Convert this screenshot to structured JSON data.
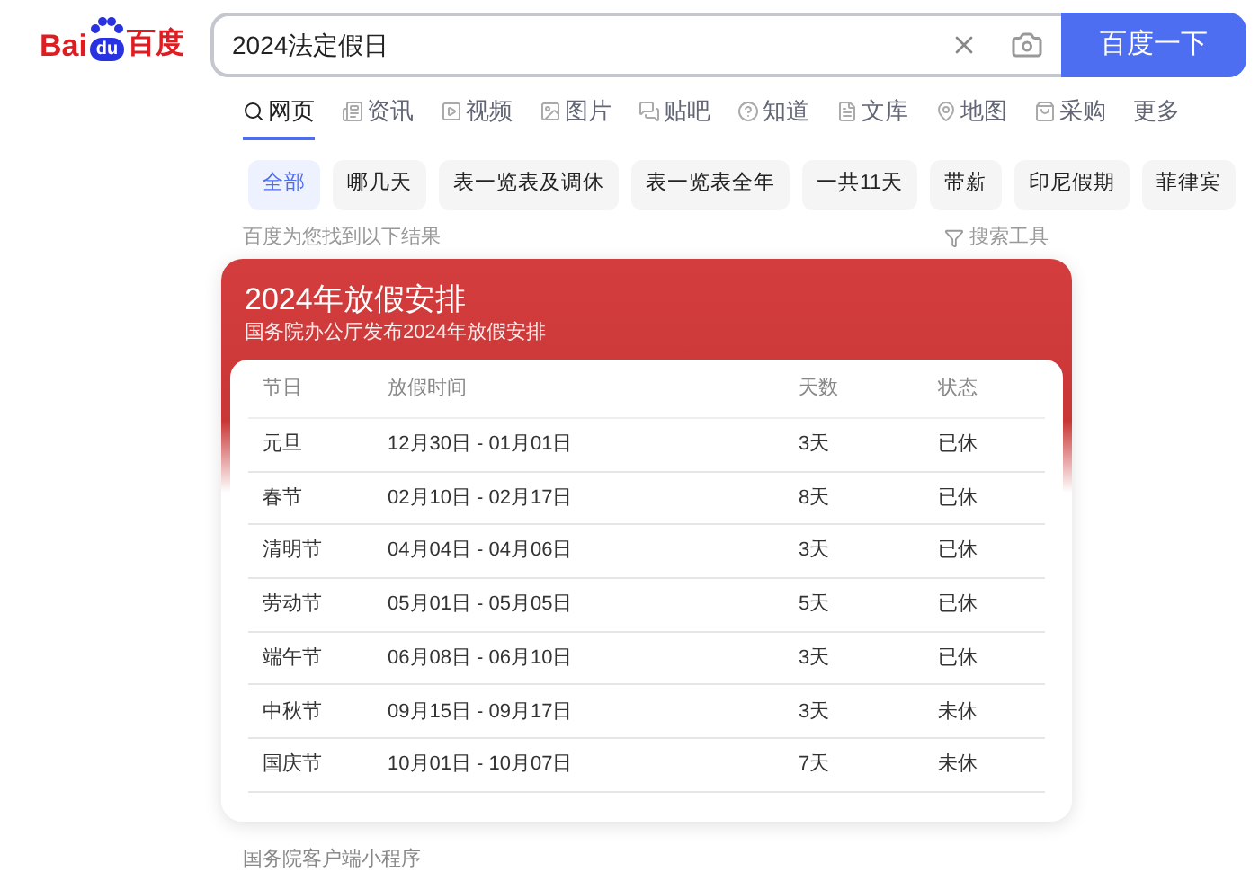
{
  "logo": {
    "left": "Bai",
    "paw": "du",
    "right": "百度"
  },
  "search": {
    "value": "2024法定假日",
    "button": "百度一下"
  },
  "tabs": [
    {
      "label": "网页",
      "kind": "search",
      "selected": true
    },
    {
      "label": "资讯",
      "kind": "news",
      "selected": false
    },
    {
      "label": "视频",
      "kind": "video",
      "selected": false
    },
    {
      "label": "图片",
      "kind": "image",
      "selected": false
    },
    {
      "label": "贴吧",
      "kind": "tieba",
      "selected": false
    },
    {
      "label": "知道",
      "kind": "question",
      "selected": false
    },
    {
      "label": "文库",
      "kind": "doc",
      "selected": false
    },
    {
      "label": "地图",
      "kind": "map",
      "selected": false
    },
    {
      "label": "采购",
      "kind": "cart",
      "selected": false
    },
    {
      "label": "更多",
      "kind": "more",
      "selected": false
    }
  ],
  "chips": [
    {
      "label": "全部",
      "selected": true
    },
    {
      "label": "哪几天",
      "selected": false
    },
    {
      "label": "表一览表及调休",
      "selected": false
    },
    {
      "label": "表一览表全年",
      "selected": false
    },
    {
      "label": "一共11天",
      "selected": false
    },
    {
      "label": "带薪",
      "selected": false
    },
    {
      "label": "印尼假期",
      "selected": false
    },
    {
      "label": "菲律宾",
      "selected": false
    }
  ],
  "result_hint": "百度为您找到以下结果",
  "search_tools": "搜索工具",
  "card": {
    "title": "2024年放假安排",
    "subtitle": "国务院办公厅发布2024年放假安排",
    "columns": [
      "节日",
      "放假时间",
      "天数",
      "状态"
    ],
    "rows": [
      [
        "元旦",
        "12月30日 - 01月01日",
        "3天",
        "已休"
      ],
      [
        "春节",
        "02月10日 - 02月17日",
        "8天",
        "已休"
      ],
      [
        "清明节",
        "04月04日 - 04月06日",
        "3天",
        "已休"
      ],
      [
        "劳动节",
        "05月01日 - 05月05日",
        "5天",
        "已休"
      ],
      [
        "端午节",
        "06月08日 - 06月10日",
        "3天",
        "已休"
      ],
      [
        "中秋节",
        "09月15日 - 09月17日",
        "3天",
        "未休"
      ],
      [
        "国庆节",
        "10月01日 - 10月07日",
        "7天",
        "未休"
      ]
    ]
  },
  "source": "国务院客户端小程序"
}
